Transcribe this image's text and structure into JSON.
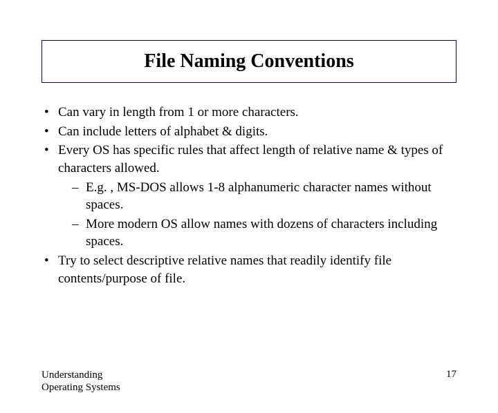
{
  "title": "File Naming Conventions",
  "bullets": {
    "b1": "Can vary in length from 1 or more characters.",
    "b2": "Can include letters of alphabet & digits.",
    "b3": "Every OS has specific rules that affect length of relative name & types of characters allowed.",
    "b3_sub1": "E.g. , MS-DOS allows 1-8 alphanumeric character names without spaces.",
    "b3_sub2": "More modern OS allow names with dozens of characters including spaces.",
    "b4": "Try to select descriptive relative names that readily identify file contents/purpose of file."
  },
  "footer": {
    "left_line1": "Understanding",
    "left_line2": "Operating Systems",
    "page": "17"
  }
}
